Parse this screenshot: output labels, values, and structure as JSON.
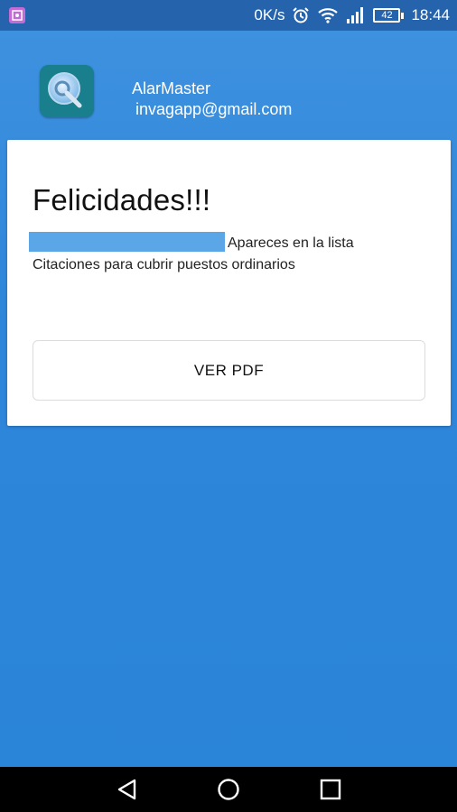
{
  "status_bar": {
    "speed": "0K/s",
    "battery": "42",
    "time": "18:44",
    "notification_icon": "gallery-notification-icon"
  },
  "header": {
    "app_name": "AlarMaster",
    "email": "invagapp@gmail.com",
    "logo_icon": "magnifier-logo-icon"
  },
  "card": {
    "title": "Felicidades!!!",
    "list_text": "Apareces en la lista",
    "list_name": "Citaciones para cubrir puestos ordinarios",
    "button_label": "VER PDF"
  },
  "nav_bar": {
    "icons": [
      "back-icon",
      "home-icon",
      "recents-icon"
    ]
  },
  "colors": {
    "background": "#2e86da",
    "status_bar": "#2563ac",
    "redaction": "#5aa6e7"
  }
}
